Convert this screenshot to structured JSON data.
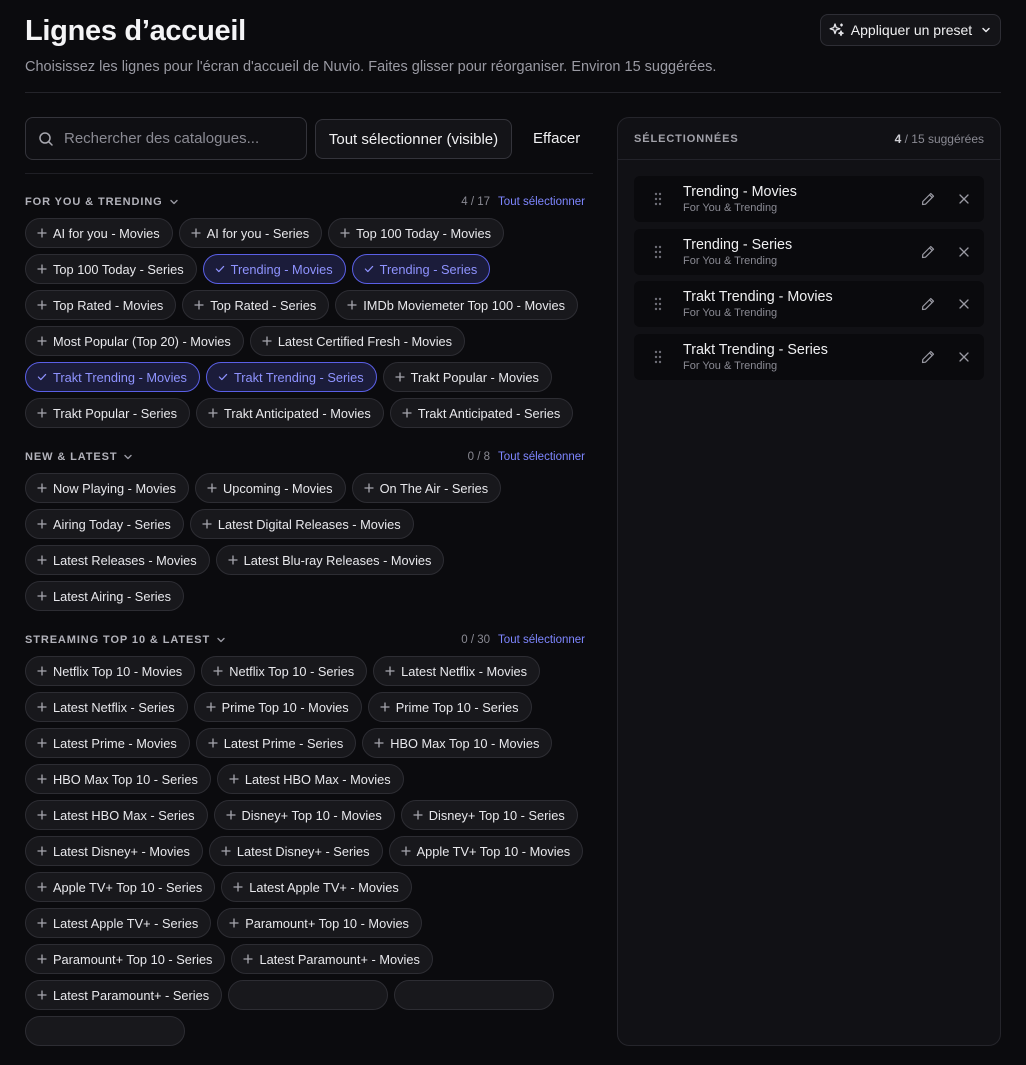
{
  "header": {
    "title": "Lignes d’accueil",
    "subtitle": "Choisissez les lignes pour l'écran d'accueil de Nuvio. Faites glisser pour réorganiser. Environ 15 suggérées.",
    "preset_label": "Appliquer un preset"
  },
  "toolbar": {
    "search_placeholder": "Rechercher des catalogues...",
    "search_value": "",
    "select_visible_label": "Tout sélectionner (visible)",
    "clear_label": "Effacer"
  },
  "sections": [
    {
      "title": "For You & Trending",
      "count": "4 / 17",
      "select_all_label": "Tout sélectionner",
      "chips": [
        {
          "label": "AI for you - Movies",
          "selected": false
        },
        {
          "label": "AI for you - Series",
          "selected": false
        },
        {
          "label": "Top 100 Today - Movies",
          "selected": false
        },
        {
          "label": "Top 100 Today - Series",
          "selected": false
        },
        {
          "label": "Trending - Movies",
          "selected": true
        },
        {
          "label": "Trending - Series",
          "selected": true
        },
        {
          "label": "Top Rated - Movies",
          "selected": false
        },
        {
          "label": "Top Rated - Series",
          "selected": false
        },
        {
          "label": "IMDb Moviemeter Top 100 - Movies",
          "selected": false
        },
        {
          "label": "Most Popular (Top 20) - Movies",
          "selected": false
        },
        {
          "label": "Latest Certified Fresh - Movies",
          "selected": false
        },
        {
          "label": "Trakt Trending - Movies",
          "selected": true
        },
        {
          "label": "Trakt Trending - Series",
          "selected": true
        },
        {
          "label": "Trakt Popular - Movies",
          "selected": false
        },
        {
          "label": "Trakt Popular - Series",
          "selected": false
        },
        {
          "label": "Trakt Anticipated - Movies",
          "selected": false
        },
        {
          "label": "Trakt Anticipated - Series",
          "selected": false
        }
      ]
    },
    {
      "title": "New & Latest",
      "count": "0 / 8",
      "select_all_label": "Tout sélectionner",
      "chips": [
        {
          "label": "Now Playing - Movies",
          "selected": false
        },
        {
          "label": "Upcoming - Movies",
          "selected": false
        },
        {
          "label": "On The Air - Series",
          "selected": false
        },
        {
          "label": "Airing Today - Series",
          "selected": false
        },
        {
          "label": "Latest Digital Releases - Movies",
          "selected": false
        },
        {
          "label": "Latest Releases - Movies",
          "selected": false
        },
        {
          "label": "Latest Blu-ray Releases - Movies",
          "selected": false
        },
        {
          "label": "Latest Airing - Series",
          "selected": false
        }
      ]
    },
    {
      "title": "Streaming Top 10 & Latest",
      "count": "0 / 30",
      "select_all_label": "Tout sélectionner",
      "chips": [
        {
          "label": "Netflix Top 10 - Movies",
          "selected": false
        },
        {
          "label": "Netflix Top 10 - Series",
          "selected": false
        },
        {
          "label": "Latest Netflix - Movies",
          "selected": false
        },
        {
          "label": "Latest Netflix - Series",
          "selected": false
        },
        {
          "label": "Prime Top 10 - Movies",
          "selected": false
        },
        {
          "label": "Prime Top 10 - Series",
          "selected": false
        },
        {
          "label": "Latest Prime - Movies",
          "selected": false
        },
        {
          "label": "Latest Prime - Series",
          "selected": false
        },
        {
          "label": "HBO Max Top 10 - Movies",
          "selected": false
        },
        {
          "label": "HBO Max Top 10 - Series",
          "selected": false
        },
        {
          "label": "Latest HBO Max - Movies",
          "selected": false
        },
        {
          "label": "Latest HBO Max - Series",
          "selected": false
        },
        {
          "label": "Disney+ Top 10 - Movies",
          "selected": false
        },
        {
          "label": "Disney+ Top 10 - Series",
          "selected": false
        },
        {
          "label": "Latest Disney+ - Movies",
          "selected": false
        },
        {
          "label": "Latest Disney+ - Series",
          "selected": false
        },
        {
          "label": "Apple TV+ Top 10 - Movies",
          "selected": false
        },
        {
          "label": "Apple TV+ Top 10 - Series",
          "selected": false
        },
        {
          "label": "Latest Apple TV+ - Movies",
          "selected": false
        },
        {
          "label": "Latest Apple TV+ - Series",
          "selected": false
        },
        {
          "label": "Paramount+ Top 10 - Movies",
          "selected": false
        },
        {
          "label": "Paramount+ Top 10 - Series",
          "selected": false
        },
        {
          "label": "Latest Paramount+ - Movies",
          "selected": false
        },
        {
          "label": "Latest Paramount+ - Series",
          "selected": false
        },
        {
          "label": "",
          "selected": false
        },
        {
          "label": "",
          "selected": false
        },
        {
          "label": "",
          "selected": false
        }
      ]
    }
  ],
  "selected_panel": {
    "title": "SÉLECTIONNÉES",
    "count_selected": "4",
    "count_suffix": " / 15 suggérées",
    "items": [
      {
        "name": "Trending - Movies",
        "category": "For You & Trending"
      },
      {
        "name": "Trending - Series",
        "category": "For You & Trending"
      },
      {
        "name": "Trakt Trending - Movies",
        "category": "For You & Trending"
      },
      {
        "name": "Trakt Trending - Series",
        "category": "For You & Trending"
      }
    ]
  },
  "colors": {
    "background": "#0b0b0e",
    "accent": "#7e86ff",
    "selected_chip_bg": "#1b1c3a",
    "selected_chip_border": "#5a5fe6"
  },
  "icons": {
    "preset": "sparkles-icon",
    "preset_caret": "chevron-down-icon",
    "search": "search-icon",
    "chip_add": "plus-icon",
    "chip_selected": "check-icon",
    "drag": "drag-handle-icon",
    "edit": "pencil-icon",
    "remove": "close-icon"
  }
}
